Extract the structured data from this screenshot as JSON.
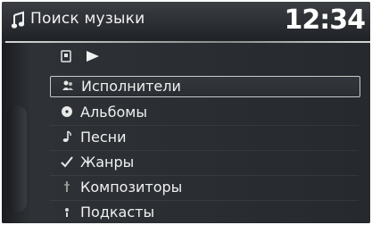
{
  "header": {
    "title": "Поиск музыки",
    "clock": "12:34"
  },
  "menu": {
    "items": [
      {
        "label": "Исполнители",
        "icon": "artist-icon",
        "selected": true
      },
      {
        "label": "Альбомы",
        "icon": "album-icon",
        "selected": false
      },
      {
        "label": "Песни",
        "icon": "song-note-icon",
        "selected": false
      },
      {
        "label": "Жанры",
        "icon": "genre-icon",
        "selected": false
      },
      {
        "label": "Композиторы",
        "icon": "composer-icon",
        "selected": false
      },
      {
        "label": "Подкасты",
        "icon": "podcast-icon",
        "selected": false
      }
    ]
  },
  "colors": {
    "background": "#2a2d31",
    "text": "#f0f0f0",
    "selection_border": "#c9c9c9"
  }
}
